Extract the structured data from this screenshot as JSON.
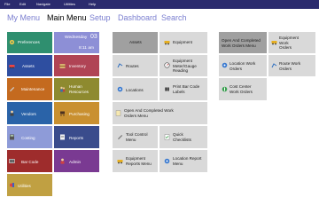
{
  "menubar": {
    "items": [
      "File",
      "Edit",
      "Navigate",
      "Utilities",
      "Help"
    ]
  },
  "nav": {
    "tabs": [
      "My Menu",
      "Main Menu",
      "Setup",
      "Dashboard",
      "Search"
    ],
    "active": "Main Menu"
  },
  "left_tiles": {
    "preferences": "Preferences",
    "date": {
      "day": "Wednesday",
      "num": "03",
      "time": "8:11 am"
    },
    "assets": "Assets",
    "inventory": "Inventory",
    "maintenance": "Maintenance",
    "human_resources": [
      "Human",
      "Resources"
    ],
    "vendors": "Vendors",
    "purchasing": "Purchasing",
    "costing": "Costing",
    "reports": "Reports",
    "bar_code": "Bar Code",
    "admin": "Admin",
    "utilities": "Utilities"
  },
  "middle_tiles": {
    "assets": "Assets",
    "equipment": "Equipment",
    "routes": "Routes",
    "equipment_meter": [
      "Equipment",
      "Meter/Gauge",
      "Reading"
    ],
    "locations": "Locations",
    "print_bar_code": [
      "Print Bar Code",
      "Labels"
    ],
    "open_completed": [
      "Open And Completed Work",
      "Orders Menu"
    ],
    "tool_control": [
      "Tool Control",
      "Menu"
    ],
    "quick_checklists": [
      "Quick",
      "Checklists"
    ],
    "equipment_reports": [
      "Equipment",
      "Reports Menu"
    ],
    "location_report": [
      "Location Report",
      "Menu"
    ]
  },
  "right_tiles": {
    "open_completed": [
      "Open And Completed",
      "Work Orders Menu"
    ],
    "equipment_work_orders": [
      "Equipment",
      "Work",
      "Orders"
    ],
    "location_work_orders": [
      "Location Work",
      "Orders"
    ],
    "route_work_orders": [
      "Route Work",
      "Orders"
    ],
    "cost_center": [
      "Cost Center",
      "Work Orders"
    ]
  },
  "colors": {
    "menubar": "#2b2b6e",
    "nav_inactive": "#7b7fd0",
    "preferences": "#2f8f6f",
    "date": "#8d8fd6",
    "assets": "#2e4ea0",
    "inventory": "#b04455",
    "maintenance": "#c46a1f",
    "human_resources": "#8e8a2f",
    "vendors": "#2a63a8",
    "purchasing": "#c99030",
    "costing": "#8e9bd8",
    "reports": "#3a4c8c",
    "bar_code": "#9e2c2c",
    "admin": "#7a3a92",
    "utilities": "#c0a042",
    "tile_gray": "#d9d9d9",
    "tile_gray_active": "#a0a0a0"
  }
}
